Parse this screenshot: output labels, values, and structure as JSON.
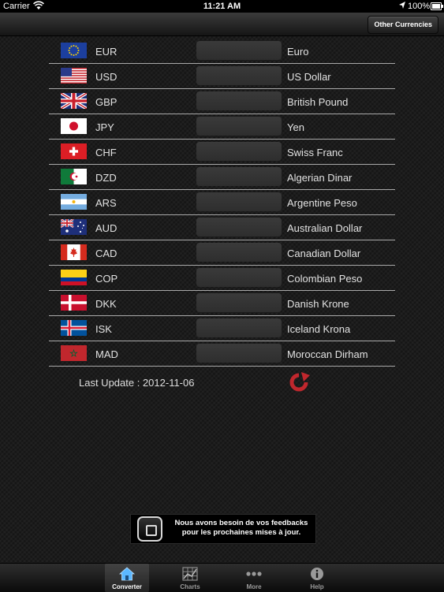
{
  "status": {
    "carrier": "Carrier",
    "time": "11:21 AM",
    "battery": "100%"
  },
  "nav": {
    "right_button": "Other Currencies"
  },
  "currencies": [
    {
      "code": "EUR",
      "name": "Euro",
      "value": ""
    },
    {
      "code": "USD",
      "name": "US Dollar",
      "value": ""
    },
    {
      "code": "GBP",
      "name": "British Pound",
      "value": ""
    },
    {
      "code": "JPY",
      "name": "Yen",
      "value": ""
    },
    {
      "code": "CHF",
      "name": "Swiss Franc",
      "value": ""
    },
    {
      "code": "DZD",
      "name": "Algerian Dinar",
      "value": ""
    },
    {
      "code": "ARS",
      "name": "Argentine Peso",
      "value": ""
    },
    {
      "code": "AUD",
      "name": "Australian Dollar",
      "value": ""
    },
    {
      "code": "CAD",
      "name": "Canadian Dollar",
      "value": ""
    },
    {
      "code": "COP",
      "name": "Colombian Peso",
      "value": ""
    },
    {
      "code": "DKK",
      "name": "Danish Krone",
      "value": ""
    },
    {
      "code": "ISK",
      "name": "Iceland Krona",
      "value": ""
    },
    {
      "code": "MAD",
      "name": "Moroccan Dirham",
      "value": ""
    }
  ],
  "last_update": "Last Update : 2012-11-06",
  "banner": {
    "line1": "Nous avons besoin de vos feedbacks",
    "line2": "pour les prochaines mises à jour."
  },
  "tabs": [
    {
      "label": "Converter",
      "icon": "home-icon",
      "active": true
    },
    {
      "label": "Charts",
      "icon": "chart-grid-icon",
      "active": false
    },
    {
      "label": "More",
      "icon": "more-dots-icon",
      "active": false
    },
    {
      "label": "Help",
      "icon": "info-icon",
      "active": false
    }
  ],
  "colors": {
    "refresh_icon": "#c0272d",
    "row_divider": "#a9a9a9"
  }
}
